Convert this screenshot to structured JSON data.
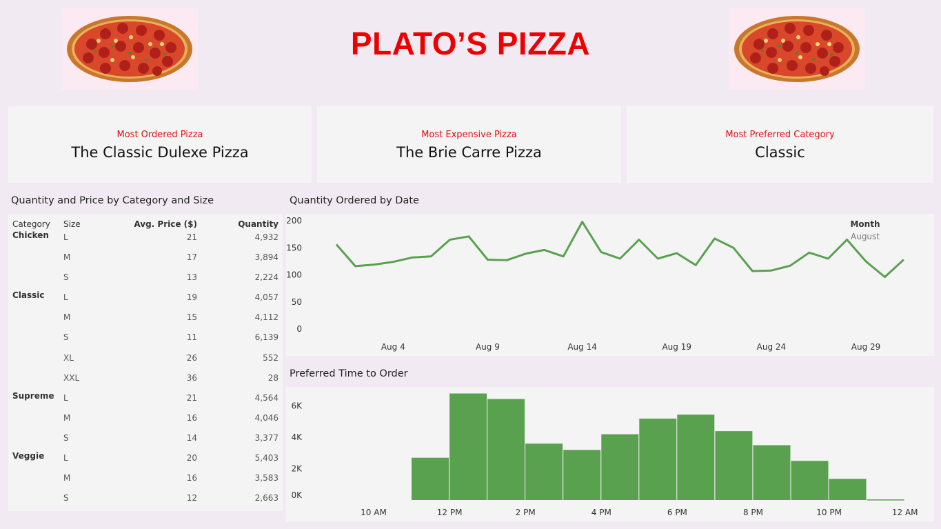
{
  "header": {
    "title": "PLATO’S PIZZA"
  },
  "kpis": [
    {
      "label": "Most Ordered Pizza",
      "value": "The Classic Dulexe Pizza"
    },
    {
      "label": "Most Expensive Pizza",
      "value": "The Brie Carre Pizza"
    },
    {
      "label": "Most Preferred Category",
      "value": "Classic"
    }
  ],
  "table_section": {
    "title": "Quantity and Price by Category and Size",
    "headers": [
      "Category",
      "Size",
      "Avg. Price ($)",
      "Quantity"
    ],
    "rows": [
      {
        "category": "Chicken",
        "size": "L",
        "price": "21",
        "quantity": "4,932"
      },
      {
        "category": "",
        "size": "M",
        "price": "17",
        "quantity": "3,894"
      },
      {
        "category": "",
        "size": "S",
        "price": "13",
        "quantity": "2,224"
      },
      {
        "category": "Classic",
        "size": "L",
        "price": "19",
        "quantity": "4,057"
      },
      {
        "category": "",
        "size": "M",
        "price": "15",
        "quantity": "4,112"
      },
      {
        "category": "",
        "size": "S",
        "price": "11",
        "quantity": "6,139"
      },
      {
        "category": "",
        "size": "XL",
        "price": "26",
        "quantity": "552"
      },
      {
        "category": "",
        "size": "XXL",
        "price": "36",
        "quantity": "28"
      },
      {
        "category": "Supreme",
        "size": "L",
        "price": "21",
        "quantity": "4,564"
      },
      {
        "category": "",
        "size": "M",
        "price": "16",
        "quantity": "4,046"
      },
      {
        "category": "",
        "size": "S",
        "price": "14",
        "quantity": "3,377"
      },
      {
        "category": "Veggie",
        "size": "L",
        "price": "20",
        "quantity": "5,403"
      },
      {
        "category": "",
        "size": "M",
        "price": "16",
        "quantity": "3,583"
      },
      {
        "category": "",
        "size": "S",
        "price": "12",
        "quantity": "2,663"
      }
    ]
  },
  "colors": {
    "title": "#ee0000",
    "kpi_label": "#e01010",
    "series": "#59a14f"
  },
  "chart_data": [
    {
      "type": "line",
      "title": "Quantity Ordered by Date",
      "legend": {
        "title": "Month",
        "value": "August"
      },
      "x_ticks": [
        "Aug 4",
        "Aug 9",
        "Aug 14",
        "Aug 19",
        "Aug 24",
        "Aug 29"
      ],
      "x_tick_days": [
        4,
        9,
        14,
        19,
        24,
        29
      ],
      "y_ticks": [
        0,
        50,
        100,
        150,
        200
      ],
      "ylim": [
        0,
        200
      ],
      "x": [
        1,
        2,
        3,
        4,
        5,
        6,
        7,
        8,
        9,
        10,
        11,
        12,
        13,
        14,
        15,
        16,
        17,
        18,
        19,
        20,
        21,
        22,
        23,
        24,
        25,
        26,
        27,
        28,
        29,
        30,
        31
      ],
      "values": [
        156,
        116,
        119,
        124,
        132,
        134,
        165,
        171,
        128,
        127,
        139,
        146,
        134,
        198,
        142,
        130,
        165,
        130,
        140,
        118,
        167,
        150,
        107,
        108,
        117,
        141,
        130,
        165,
        125,
        96,
        128
      ]
    },
    {
      "type": "bar",
      "title": "Preferred Time to Order",
      "x_ticks": [
        "10 AM",
        "12 PM",
        "2 PM",
        "4 PM",
        "6 PM",
        "8 PM",
        "10 PM",
        "12 AM"
      ],
      "y_ticks": [
        "0K",
        "2K",
        "4K",
        "6K"
      ],
      "ylim": [
        0,
        7000
      ],
      "categories": [
        "11 AM",
        "12 PM",
        "1 PM",
        "2 PM",
        "3 PM",
        "4 PM",
        "5 PM",
        "6 PM",
        "7 PM",
        "8 PM",
        "9 PM",
        "10 PM",
        "11 PM"
      ],
      "values": [
        2700,
        6800,
        6450,
        3600,
        3200,
        4200,
        5200,
        5450,
        4400,
        3500,
        2500,
        1350,
        40
      ]
    }
  ]
}
